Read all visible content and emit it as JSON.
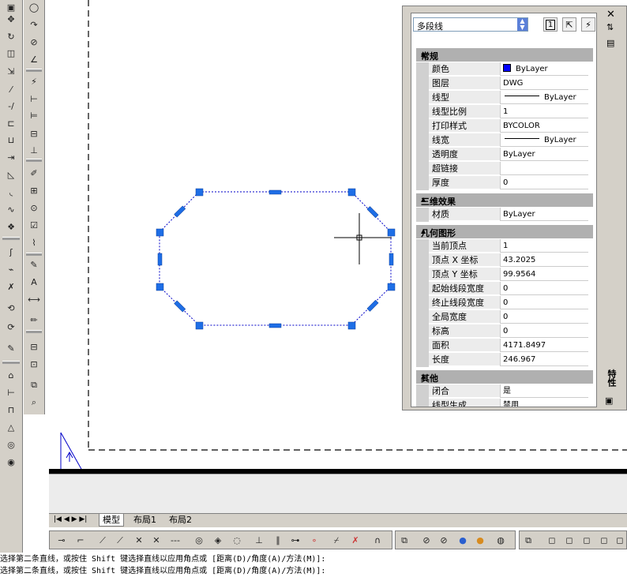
{
  "palette": {
    "object_type": "多段线",
    "quick_select_label": "1",
    "side_title": "特性",
    "sections": [
      {
        "title": "常规",
        "rows": [
          {
            "label": "颜色",
            "value": "ByLayer",
            "swatch": "#0000ff"
          },
          {
            "label": "图层",
            "value": "DWG"
          },
          {
            "label": "线型",
            "value": "ByLayer",
            "line": true
          },
          {
            "label": "线型比例",
            "value": "1"
          },
          {
            "label": "打印样式",
            "value": "BYCOLOR"
          },
          {
            "label": "线宽",
            "value": "ByLayer",
            "line": true
          },
          {
            "label": "透明度",
            "value": "ByLayer"
          },
          {
            "label": "超链接",
            "value": ""
          },
          {
            "label": "厚度",
            "value": "0"
          }
        ]
      },
      {
        "title": "三维效果",
        "rows": [
          {
            "label": "材质",
            "value": "ByLayer"
          }
        ]
      },
      {
        "title": "几何图形",
        "rows": [
          {
            "label": "当前顶点",
            "value": "1"
          },
          {
            "label": "顶点 X 坐标",
            "value": "43.2025"
          },
          {
            "label": "顶点 Y 坐标",
            "value": "99.9564"
          },
          {
            "label": "起始线段宽度",
            "value": "0"
          },
          {
            "label": "终止线段宽度",
            "value": "0"
          },
          {
            "label": "全局宽度",
            "value": "0"
          },
          {
            "label": "标高",
            "value": "0"
          },
          {
            "label": "面积",
            "value": "4171.8497"
          },
          {
            "label": "长度",
            "value": "246.967"
          }
        ]
      },
      {
        "title": "其他",
        "rows": [
          {
            "label": "闭合",
            "value": "是"
          },
          {
            "label": "线型生成",
            "value": "禁用"
          }
        ]
      }
    ]
  },
  "layout_tabs": [
    "模型",
    "布局1",
    "布局2"
  ],
  "command_lines": [
    "选择第二条直线，或按住 Shift 键选择直线以应用角点或 [距离(D)/角度(A)/方法(M)]:",
    "选择第二条直线，或按住 Shift 键选择直线以应用角点或 [距离(D)/角度(A)/方法(M)]:"
  ],
  "colors": {
    "grip": "#1e6ee6",
    "selection": "#0000c8",
    "swatch_blue": "#0000ff"
  }
}
